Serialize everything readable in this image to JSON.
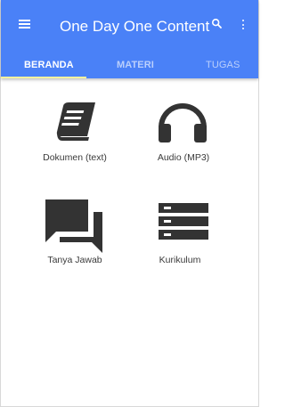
{
  "app": {
    "title": "One Day One Content"
  },
  "toolbar": {
    "menu_icon": "menu-icon",
    "search_icon": "search-icon",
    "more_icon": "more-vert-icon"
  },
  "tabs": [
    {
      "label": "BERANDA",
      "active": true
    },
    {
      "label": "MATERI",
      "active": false
    },
    {
      "label": "TUGAS",
      "active": false
    }
  ],
  "menu": {
    "items": [
      {
        "label": "Dokumen (text)",
        "icon": "book-icon"
      },
      {
        "label": "Audio (MP3)",
        "icon": "headphones-icon"
      },
      {
        "label": "Tanya Jawab",
        "icon": "forum-icon"
      },
      {
        "label": "Kurikulum",
        "icon": "list-icon"
      }
    ]
  },
  "colors": {
    "primary": "#4a81f7",
    "tab_indicator": "#f2f2a0",
    "icon": "#333333",
    "label": "#3a3a3a"
  }
}
